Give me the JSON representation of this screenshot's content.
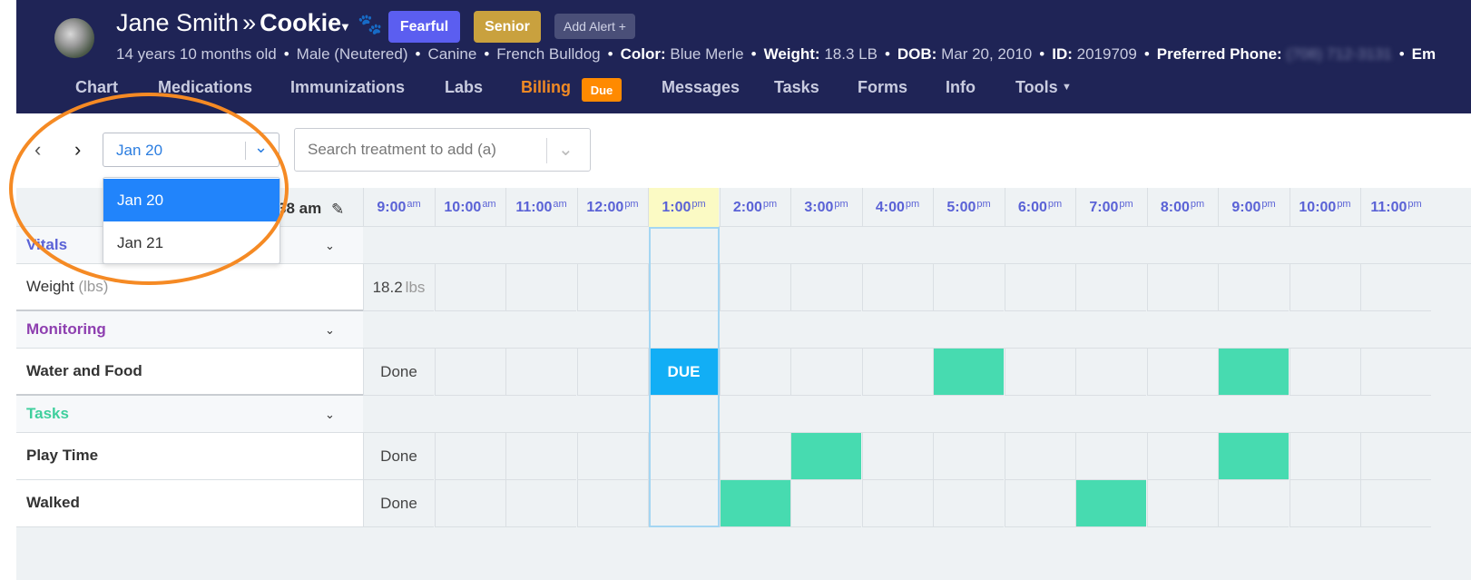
{
  "header": {
    "owner": "Jane Smith",
    "separator": "»",
    "pet": "Cookie",
    "badges": {
      "fearful": "Fearful",
      "senior": "Senior",
      "add_alert": "Add Alert +"
    },
    "info": {
      "age": "14 years 10 months old",
      "sex": "Male (Neutered)",
      "species": "Canine",
      "breed": "French Bulldog",
      "color_label": "Color:",
      "color_value": "Blue Merle",
      "weight_label": "Weight:",
      "weight_value": "18.3 LB",
      "dob_label": "DOB:",
      "dob_value": "Mar 20, 2010",
      "id_label": "ID:",
      "id_value": "2019709",
      "phone_label": "Preferred Phone:",
      "phone_value": "(708) 712-3131",
      "email_label": "Em"
    },
    "nav": [
      "Chart",
      "Medications",
      "Immunizations",
      "Labs",
      "Billing",
      "Messages",
      "Tasks",
      "Forms",
      "Info",
      "Tools"
    ],
    "billing_badge": "Due",
    "tools_caret": "▼"
  },
  "toolbar": {
    "date_value": "Jan 20",
    "search_placeholder": "Search treatment to add (a)",
    "date_options": [
      "Jan 20",
      "Jan 21"
    ]
  },
  "grid": {
    "time_header": "38 am",
    "times": [
      {
        "h": "9:00",
        "p": "am"
      },
      {
        "h": "10:00",
        "p": "am"
      },
      {
        "h": "11:00",
        "p": "am"
      },
      {
        "h": "12:00",
        "p": "pm"
      },
      {
        "h": "1:00",
        "p": "pm"
      },
      {
        "h": "2:00",
        "p": "pm"
      },
      {
        "h": "3:00",
        "p": "pm"
      },
      {
        "h": "4:00",
        "p": "pm"
      },
      {
        "h": "5:00",
        "p": "pm"
      },
      {
        "h": "6:00",
        "p": "pm"
      },
      {
        "h": "7:00",
        "p": "pm"
      },
      {
        "h": "8:00",
        "p": "pm"
      },
      {
        "h": "9:00",
        "p": "pm"
      },
      {
        "h": "10:00",
        "p": "pm"
      },
      {
        "h": "11:00",
        "p": "pm"
      }
    ],
    "groups": {
      "vitals": {
        "label": "Vitals",
        "color": "#5a62d6"
      },
      "monitoring": {
        "label": "Monitoring",
        "color": "#8e3fb0"
      },
      "tasks": {
        "label": "Tasks",
        "color": "#3fcf9d"
      }
    },
    "rows": {
      "weight": {
        "label": "Weight",
        "unit": "(lbs)",
        "value": "18.2",
        "value_unit": "lbs"
      },
      "water_food": {
        "label": "Water and Food",
        "done": "Done",
        "due": "DUE"
      },
      "play_time": {
        "label": "Play Time",
        "done": "Done"
      },
      "walked": {
        "label": "Walked",
        "done": "Done"
      }
    }
  },
  "colors": {
    "header_bg": "#1f2456",
    "accent": "#2184fb",
    "scheduled": "#47dbb0",
    "due": "#12aef5",
    "highlight_ring": "#f58a24"
  }
}
